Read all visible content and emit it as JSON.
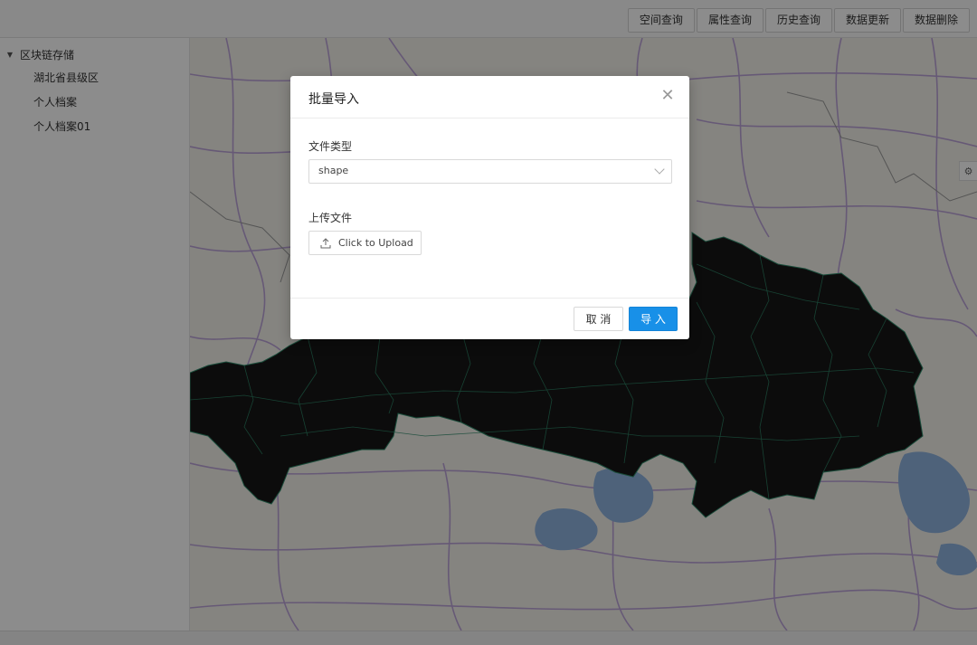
{
  "toolbar": {
    "buttons": [
      "空间查询",
      "属性查询",
      "历史查询",
      "数据更新",
      "数据删除"
    ]
  },
  "sidebar": {
    "root_label": "区块链存储",
    "items": [
      "湖北省县级区",
      "个人档案",
      "个人档案01"
    ]
  },
  "map": {
    "settings_icon": "gear-icon",
    "colors": {
      "background": "#f3f1ea",
      "roads": "#b59ad6",
      "water": "#8fb3df",
      "region_fill": "#161616",
      "region_border": "#2f8a6a"
    }
  },
  "modal": {
    "title": "批量导入",
    "close_icon": "close-icon",
    "file_type_label": "文件类型",
    "file_type_value": "shape",
    "upload_label": "上传文件",
    "upload_button": "Click to Upload",
    "cancel_button": "取 消",
    "ok_button": "导 入",
    "primary_color": "#1890e8"
  }
}
